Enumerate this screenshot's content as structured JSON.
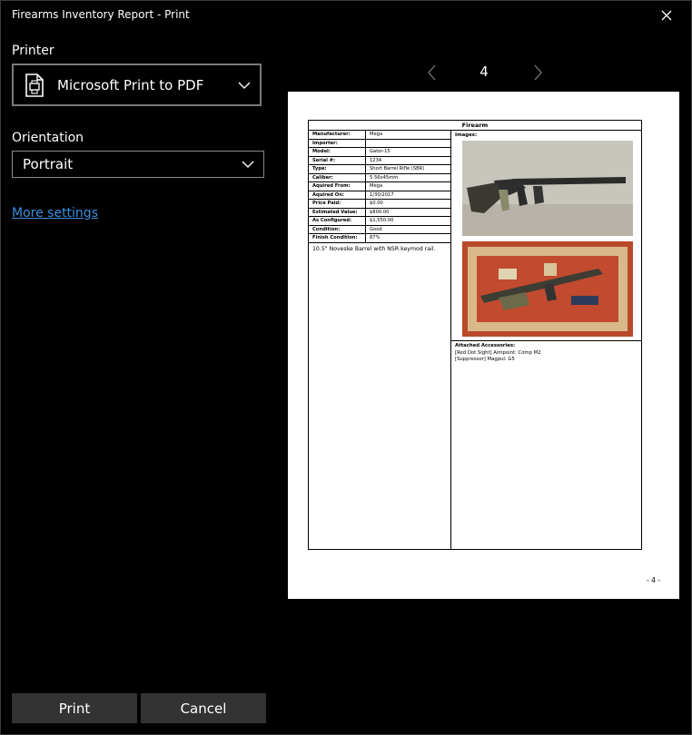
{
  "window": {
    "title": "Firearms Inventory Report - Print"
  },
  "printer": {
    "label": "Printer",
    "value": "Microsoft Print to PDF"
  },
  "orientation": {
    "label": "Orientation",
    "value": "Portrait"
  },
  "more_settings": "More settings",
  "pager": {
    "current": "4"
  },
  "preview": {
    "heading": "Firearm",
    "fields": [
      {
        "label": "Manufacturer:",
        "value": "Mega"
      },
      {
        "label": "Importer:",
        "value": ""
      },
      {
        "label": "Model:",
        "value": "Gator-15"
      },
      {
        "label": "Serial #:",
        "value": "1234"
      },
      {
        "label": "Type:",
        "value": "Short Barrel Rifle (SBR)"
      },
      {
        "label": "Caliber:",
        "value": "5.56x45mm"
      },
      {
        "label": "Aquired From:",
        "value": "Mega"
      },
      {
        "label": "Aquired On:",
        "value": "1/30/2017"
      },
      {
        "label": "Price Paid:",
        "value": "$0.00"
      },
      {
        "label": "Estimated Value:",
        "value": "$800.00"
      },
      {
        "label": "As Configured:",
        "value": "$1,550.00"
      },
      {
        "label": "Condition:",
        "value": "Good"
      },
      {
        "label": "Finish Condition:",
        "value": "87%"
      }
    ],
    "notes": "10.5\" Noveske Barrel with NSR keymod rail.",
    "images_label": "Images:",
    "accessories_label": "Attached Accessories:",
    "accessories": [
      "[Red Dot Sight] Aimpoint: Comp M2",
      "[Suppressor] Magpul: G5"
    ],
    "page_footer": "- 4 -"
  },
  "buttons": {
    "print": "Print",
    "cancel": "Cancel"
  }
}
